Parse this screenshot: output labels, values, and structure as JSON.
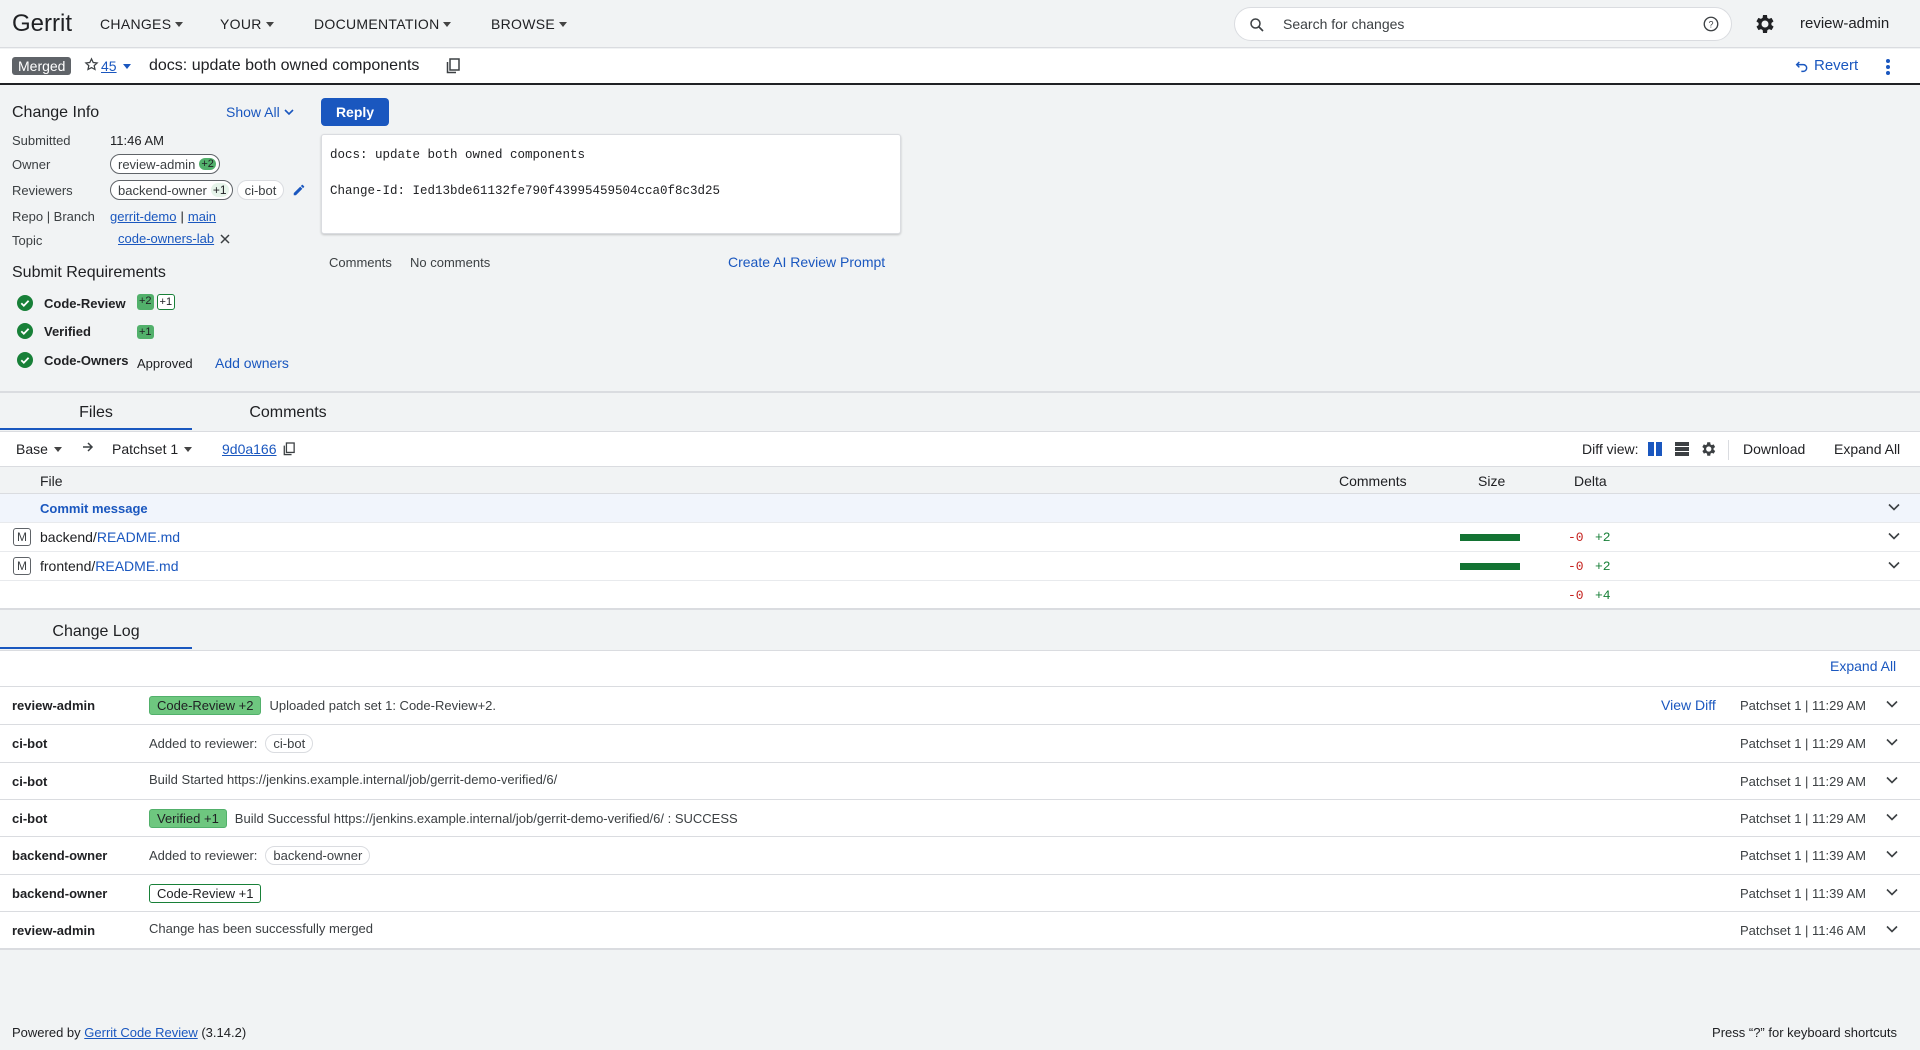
{
  "nav": {
    "logo": "Gerrit",
    "menus": [
      "CHANGES",
      "YOUR",
      "DOCUMENTATION",
      "BROWSE"
    ],
    "search_placeholder": "Search for changes",
    "user": "review-admin"
  },
  "change": {
    "status": "Merged",
    "number": "45",
    "subject": "docs: update both owned components",
    "revert_label": "Revert"
  },
  "info": {
    "title": "Change Info",
    "show_all": "Show All",
    "submitted_label": "Submitted",
    "submitted_value": "11:46 AM",
    "owner_label": "Owner",
    "owner": "review-admin",
    "owner_vote": "+2",
    "reviewers_label": "Reviewers",
    "reviewer1": "backend-owner",
    "reviewer1_vote": "+1",
    "reviewer2": "ci-bot",
    "repo_label": "Repo | Branch",
    "repo": "gerrit-demo",
    "branch_sep": "|",
    "branch": "main",
    "topic_label": "Topic",
    "topic": "code-owners-lab"
  },
  "submit_requirements": {
    "title": "Submit Requirements",
    "items": [
      {
        "name": "Code-Review",
        "votes": [
          "+2",
          "+1"
        ]
      },
      {
        "name": "Verified",
        "votes": [
          "+1"
        ]
      },
      {
        "name": "Code-Owners",
        "status": "Approved",
        "action": "Add owners"
      }
    ]
  },
  "commit": {
    "reply_label": "Reply",
    "message_line1": "docs: update both owned components",
    "message_line2": "Change-Id: Ied13bde61132fe790f43995459504cca0f8c3d25",
    "comments_label": "Comments",
    "comments_value": "No comments",
    "ai_prompt": "Create AI Review Prompt"
  },
  "files_tabs": [
    "Files",
    "Comments"
  ],
  "filebar": {
    "base": "Base",
    "patchset": "Patchset 1",
    "commit_hash": "9d0a166",
    "diff_view_label": "Diff view:",
    "download": "Download",
    "expand_all": "Expand All"
  },
  "files_table": {
    "headers": [
      "File",
      "Comments",
      "Size",
      "Delta"
    ],
    "commit_message_label": "Commit message",
    "rows": [
      {
        "status": "M",
        "dir": "backend/",
        "file": "README.md",
        "size_fraction": 1.0,
        "del": "-0",
        "add": "+2"
      },
      {
        "status": "M",
        "dir": "frontend/",
        "file": "README.md",
        "size_fraction": 1.0,
        "del": "-0",
        "add": "+2"
      }
    ],
    "total_del": "-0",
    "total_add": "+4"
  },
  "changelog": {
    "tab": "Change Log",
    "expand_all": "Expand All",
    "view_diff": "View Diff",
    "entries": [
      {
        "author": "review-admin",
        "label": "Code-Review +2",
        "label_style": "filled",
        "text": "Uploaded patch set 1: Code-Review+2.",
        "meta": "Patchset 1 | 11:29 AM"
      },
      {
        "author": "ci-bot",
        "text": "Added to reviewer:",
        "chip": "ci-bot",
        "meta": "Patchset 1 | 11:29 AM"
      },
      {
        "author": "ci-bot",
        "text": "Build Started https://jenkins.example.internal/job/gerrit-demo-verified/6/",
        "meta": "Patchset 1 | 11:29 AM"
      },
      {
        "author": "ci-bot",
        "label": "Verified +1",
        "label_style": "filled",
        "text": "Build Successful https://jenkins.example.internal/job/gerrit-demo-verified/6/ : SUCCESS",
        "meta": "Patchset 1 | 11:29 AM"
      },
      {
        "author": "backend-owner",
        "text": "Added to reviewer:",
        "chip": "backend-owner",
        "meta": "Patchset 1 | 11:39 AM"
      },
      {
        "author": "backend-owner",
        "label": "Code-Review +1",
        "label_style": "outline",
        "text": "",
        "meta": "Patchset 1 | 11:39 AM"
      },
      {
        "author": "review-admin",
        "text": "Change has been successfully merged",
        "meta": "Patchset 1 | 11:46 AM"
      }
    ]
  },
  "footer": {
    "powered_prefix": "Powered by",
    "powered_link": "Gerrit Code Review",
    "version": "(3.14.2)",
    "shortcuts": "Press “?” for keyboard shortcuts"
  }
}
